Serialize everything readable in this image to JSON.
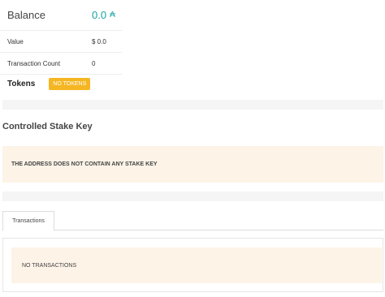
{
  "summary": {
    "balance_label": "Balance",
    "balance_value": "0.0",
    "balance_icon": "ada-icon",
    "value_label": "Value",
    "value_amount": "$ 0.0",
    "tx_count_label": "Transaction Count",
    "tx_count_value": "0"
  },
  "tokens": {
    "title": "Tokens",
    "badge": "NO TOKENS"
  },
  "stake": {
    "title": "Controlled Stake Key",
    "notice": "THE ADDRESS DOES NOT CONTAIN ANY STAKE KEY"
  },
  "tabs": [
    {
      "label": "Transactions",
      "active": true
    }
  ],
  "transactions": {
    "empty_text": "NO TRANSACTIONS"
  },
  "colors": {
    "accent": "#1aa3a3",
    "badge": "#f5b623",
    "notice_bg": "#fdf3e7",
    "band_bg": "#f5f5f5"
  }
}
